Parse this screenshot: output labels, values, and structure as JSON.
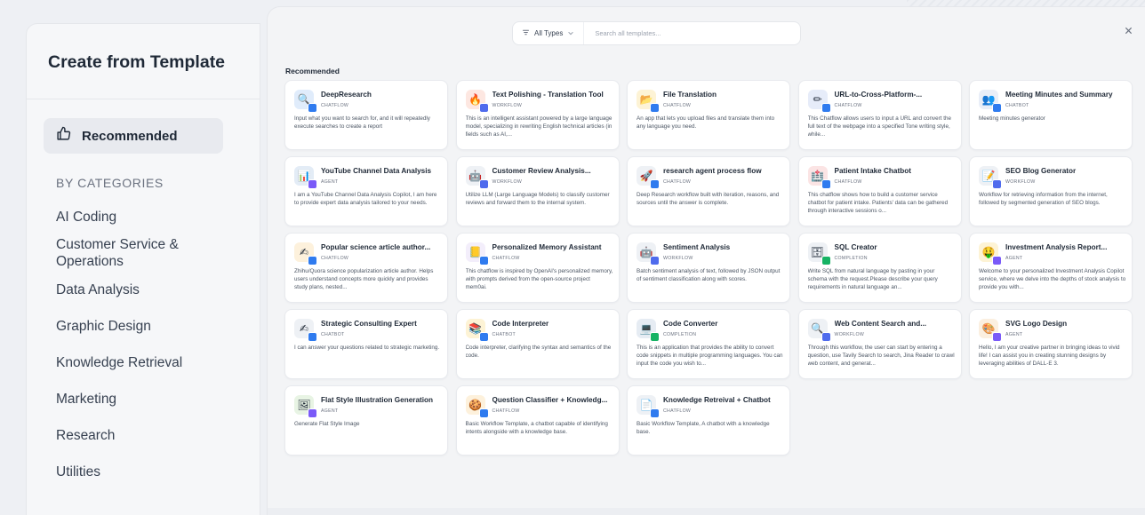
{
  "sidebar": {
    "title": "Create from Template",
    "recommended_label": "Recommended",
    "categories_heading": "BY CATEGORIES",
    "categories": [
      "AI Coding",
      "Customer Service & Operations",
      "Data Analysis",
      "Graphic Design",
      "Knowledge Retrieval",
      "Marketing",
      "Research",
      "Utilities"
    ]
  },
  "search": {
    "filter_label": "All Types",
    "placeholder": "Search all templates..."
  },
  "section_title": "Recommended",
  "templates": [
    {
      "title": "DeepResearch",
      "type": "CHATFLOW",
      "icon": "magnifier-icon",
      "icon_glyph": "🔍",
      "icon_bg": "#e0ecfb",
      "badge_color": "#2f7bef",
      "desc": "Input what you want to search for, and it will repeatedly execute searches to create a report"
    },
    {
      "title": "Text Polishing - Translation Tool",
      "type": "WORKFLOW",
      "icon": "fire-icon",
      "icon_glyph": "🔥",
      "icon_bg": "#fde7e1",
      "badge_color": "#4f6bed",
      "desc": "This is an intelligent assistant powered by a large language model, specializing in rewriting English technical articles (in fields such as AI,..."
    },
    {
      "title": "File Translation",
      "type": "CHATFLOW",
      "icon": "folder-icon",
      "icon_glyph": "📂",
      "icon_bg": "#fdf3d5",
      "badge_color": "#2f7bef",
      "desc": "An app that lets you upload files and translate them into any language you need."
    },
    {
      "title": "URL-to-Cross-Platform-...",
      "type": "CHATFLOW",
      "icon": "pencil-icon",
      "icon_glyph": "✏",
      "icon_bg": "#e6ecf9",
      "badge_color": "#2f7bef",
      "desc": "This Chatflow allows users to input a URL and convert the full text of the webpage into a specified Tone writing style, while..."
    },
    {
      "title": "Meeting Minutes and Summary",
      "type": "CHATBOT",
      "icon": "people-icon",
      "icon_glyph": "👥",
      "icon_bg": "#e9eef8",
      "badge_color": "#2f7bef",
      "desc": "Meeting minutes generator"
    },
    {
      "title": "YouTube Channel Data Analysis",
      "type": "AGENT",
      "icon": "chart-icon",
      "icon_glyph": "📊",
      "icon_bg": "#e3ecf6",
      "badge_color": "#7a5af8",
      "desc": "I am a YouTube Channel Data Analysis Copilot, I am here to provide expert data analysis tailored to your needs."
    },
    {
      "title": "Customer Review Analysis...",
      "type": "WORKFLOW",
      "icon": "robot-icon",
      "icon_glyph": "🤖",
      "icon_bg": "#eef1f5",
      "badge_color": "#4f6bed",
      "desc": "Utilize LLM (Large Language Models) to classify customer reviews and forward them to the internal system."
    },
    {
      "title": "research agent process flow",
      "type": "CHATFLOW",
      "icon": "rocket-icon",
      "icon_glyph": "🚀",
      "icon_bg": "#eef1f5",
      "badge_color": "#2f7bef",
      "desc": "Deep Research workflow built with iteration, reasons, and sources until the answer is complete."
    },
    {
      "title": "Patient Intake Chatbot",
      "type": "CHATFLOW",
      "icon": "medical-icon",
      "icon_glyph": "🏥",
      "icon_bg": "#fbe4e4",
      "badge_color": "#2f7bef",
      "desc": "This chatflow shows how to build a customer service chatbot for patient intake. Patients' data can be gathered through interactive sessions o..."
    },
    {
      "title": "SEO Blog Generator",
      "type": "WORKFLOW",
      "icon": "document-icon",
      "icon_glyph": "📝",
      "icon_bg": "#eef1f5",
      "badge_color": "#4f6bed",
      "desc": "Workflow for retrieving information from the internet, followed by segmented generation of SEO blogs."
    },
    {
      "title": "Popular science article author...",
      "type": "CHATFLOW",
      "icon": "pen-icon",
      "icon_glyph": "✍",
      "icon_bg": "#fdf1dc",
      "badge_color": "#2f7bef",
      "desc": "Zhihu/Quora science popularization article author. Helps users understand concepts more quickly and provides study plans, nested..."
    },
    {
      "title": "Personalized Memory Assistant",
      "type": "CHATFLOW",
      "icon": "memo-icon",
      "icon_glyph": "📒",
      "icon_bg": "#f3eefb",
      "badge_color": "#2f7bef",
      "desc": "This chatflow is inspired by OpenAI's personalized memory, with prompts derived from the open-source project mem0ai."
    },
    {
      "title": "Sentiment Analysis",
      "type": "WORKFLOW",
      "icon": "robot-icon",
      "icon_glyph": "🤖",
      "icon_bg": "#eef1f5",
      "badge_color": "#4f6bed",
      "desc": "Batch sentiment analysis of text, followed by JSON output of sentiment classification along with scores."
    },
    {
      "title": "SQL Creator",
      "type": "COMPLETION",
      "icon": "database-icon",
      "icon_glyph": "🗄",
      "icon_bg": "#eef1f5",
      "badge_color": "#16b364",
      "desc": "Write SQL from natural language by pasting in your schema with the request.Please describe your query requirements in natural language an..."
    },
    {
      "title": "Investment Analysis Report...",
      "type": "AGENT",
      "icon": "money-icon",
      "icon_glyph": "🤑",
      "icon_bg": "#fdf3d5",
      "badge_color": "#7a5af8",
      "desc": "Welcome to your personalized Investment Analysis Copilot service, where we delve into the depths of stock analysis to provide you with..."
    },
    {
      "title": "Strategic Consulting Expert",
      "type": "CHATBOT",
      "icon": "pen-icon",
      "icon_glyph": "✍",
      "icon_bg": "#eef1f5",
      "badge_color": "#2f7bef",
      "desc": "I can answer your questions related to strategic marketing."
    },
    {
      "title": "Code Interpreter",
      "type": "CHATBOT",
      "icon": "book-icon",
      "icon_glyph": "📚",
      "icon_bg": "#fdf3d5",
      "badge_color": "#2f7bef",
      "desc": "Code interpreter, clarifying the syntax and semantics of the code."
    },
    {
      "title": "Code Converter",
      "type": "COMPLETION",
      "icon": "laptop-icon",
      "icon_glyph": "💻",
      "icon_bg": "#e6ecf3",
      "badge_color": "#16b364",
      "desc": "This is an application that provides the ability to convert code snippets in multiple programming languages. You can input the code you wish to..."
    },
    {
      "title": "Web Content Search and...",
      "type": "WORKFLOW",
      "icon": "magnifier-icon",
      "icon_glyph": "🔍",
      "icon_bg": "#eef1f5",
      "badge_color": "#4f6bed",
      "desc": "Through this workflow, the user can start by entering a question, use Tavily Search to search, Jina Reader to crawl web content, and generat..."
    },
    {
      "title": "SVG Logo Design",
      "type": "AGENT",
      "icon": "palette-icon",
      "icon_glyph": "🎨",
      "icon_bg": "#fbefe0",
      "badge_color": "#7a5af8",
      "desc": "Hello, I am your creative partner in bringing ideas to vivid life! I can assist you in creating stunning designs by leveraging abilities of DALL-E 3."
    },
    {
      "title": "Flat Style Illustration Generation",
      "type": "AGENT",
      "icon": "picture-icon",
      "icon_glyph": "🖼",
      "icon_bg": "#e8f4e4",
      "badge_color": "#7a5af8",
      "desc": "Generate Flat Style Image"
    },
    {
      "title": "Question Classifier + Knowledg...",
      "type": "CHATFLOW",
      "icon": "cookie-icon",
      "icon_glyph": "🍪",
      "icon_bg": "#fdf1dc",
      "badge_color": "#2f7bef",
      "desc": "Basic Workflow Template, a chatbot capable of identifying intents alongside with a knowledge base."
    },
    {
      "title": "Knowledge Retreival + Chatbot",
      "type": "CHATFLOW",
      "icon": "document-icon",
      "icon_glyph": "📄",
      "icon_bg": "#eef1f5",
      "badge_color": "#2f7bef",
      "desc": "Basic Workflow Template, A chatbot with a knowledge base."
    }
  ]
}
